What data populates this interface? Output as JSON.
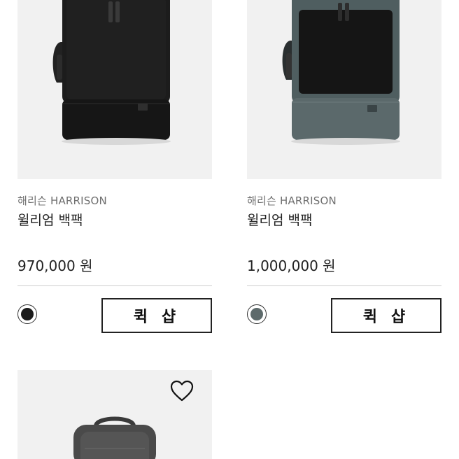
{
  "products": [
    {
      "brand": "해리슨 HARRISON",
      "name": "윌리엄 백팩",
      "price": "970,000 원",
      "swatch_color": "#1b1b1b",
      "quick_shop_label": "퀵 샵",
      "bag_body_color": "#1a1a1a",
      "bag_bottom_color": "#141414"
    },
    {
      "brand": "해리슨 HARRISON",
      "name": "윌리엄 백팩",
      "price": "1,000,000 원",
      "swatch_color": "#5d6a6b",
      "quick_shop_label": "퀵 샵",
      "bag_body_color": "#4f5e60",
      "bag_bottom_color": "#5b696b"
    },
    {
      "wishlist_icon": "heart-outline-icon",
      "bag_body_color": "#4a4a4a"
    }
  ]
}
